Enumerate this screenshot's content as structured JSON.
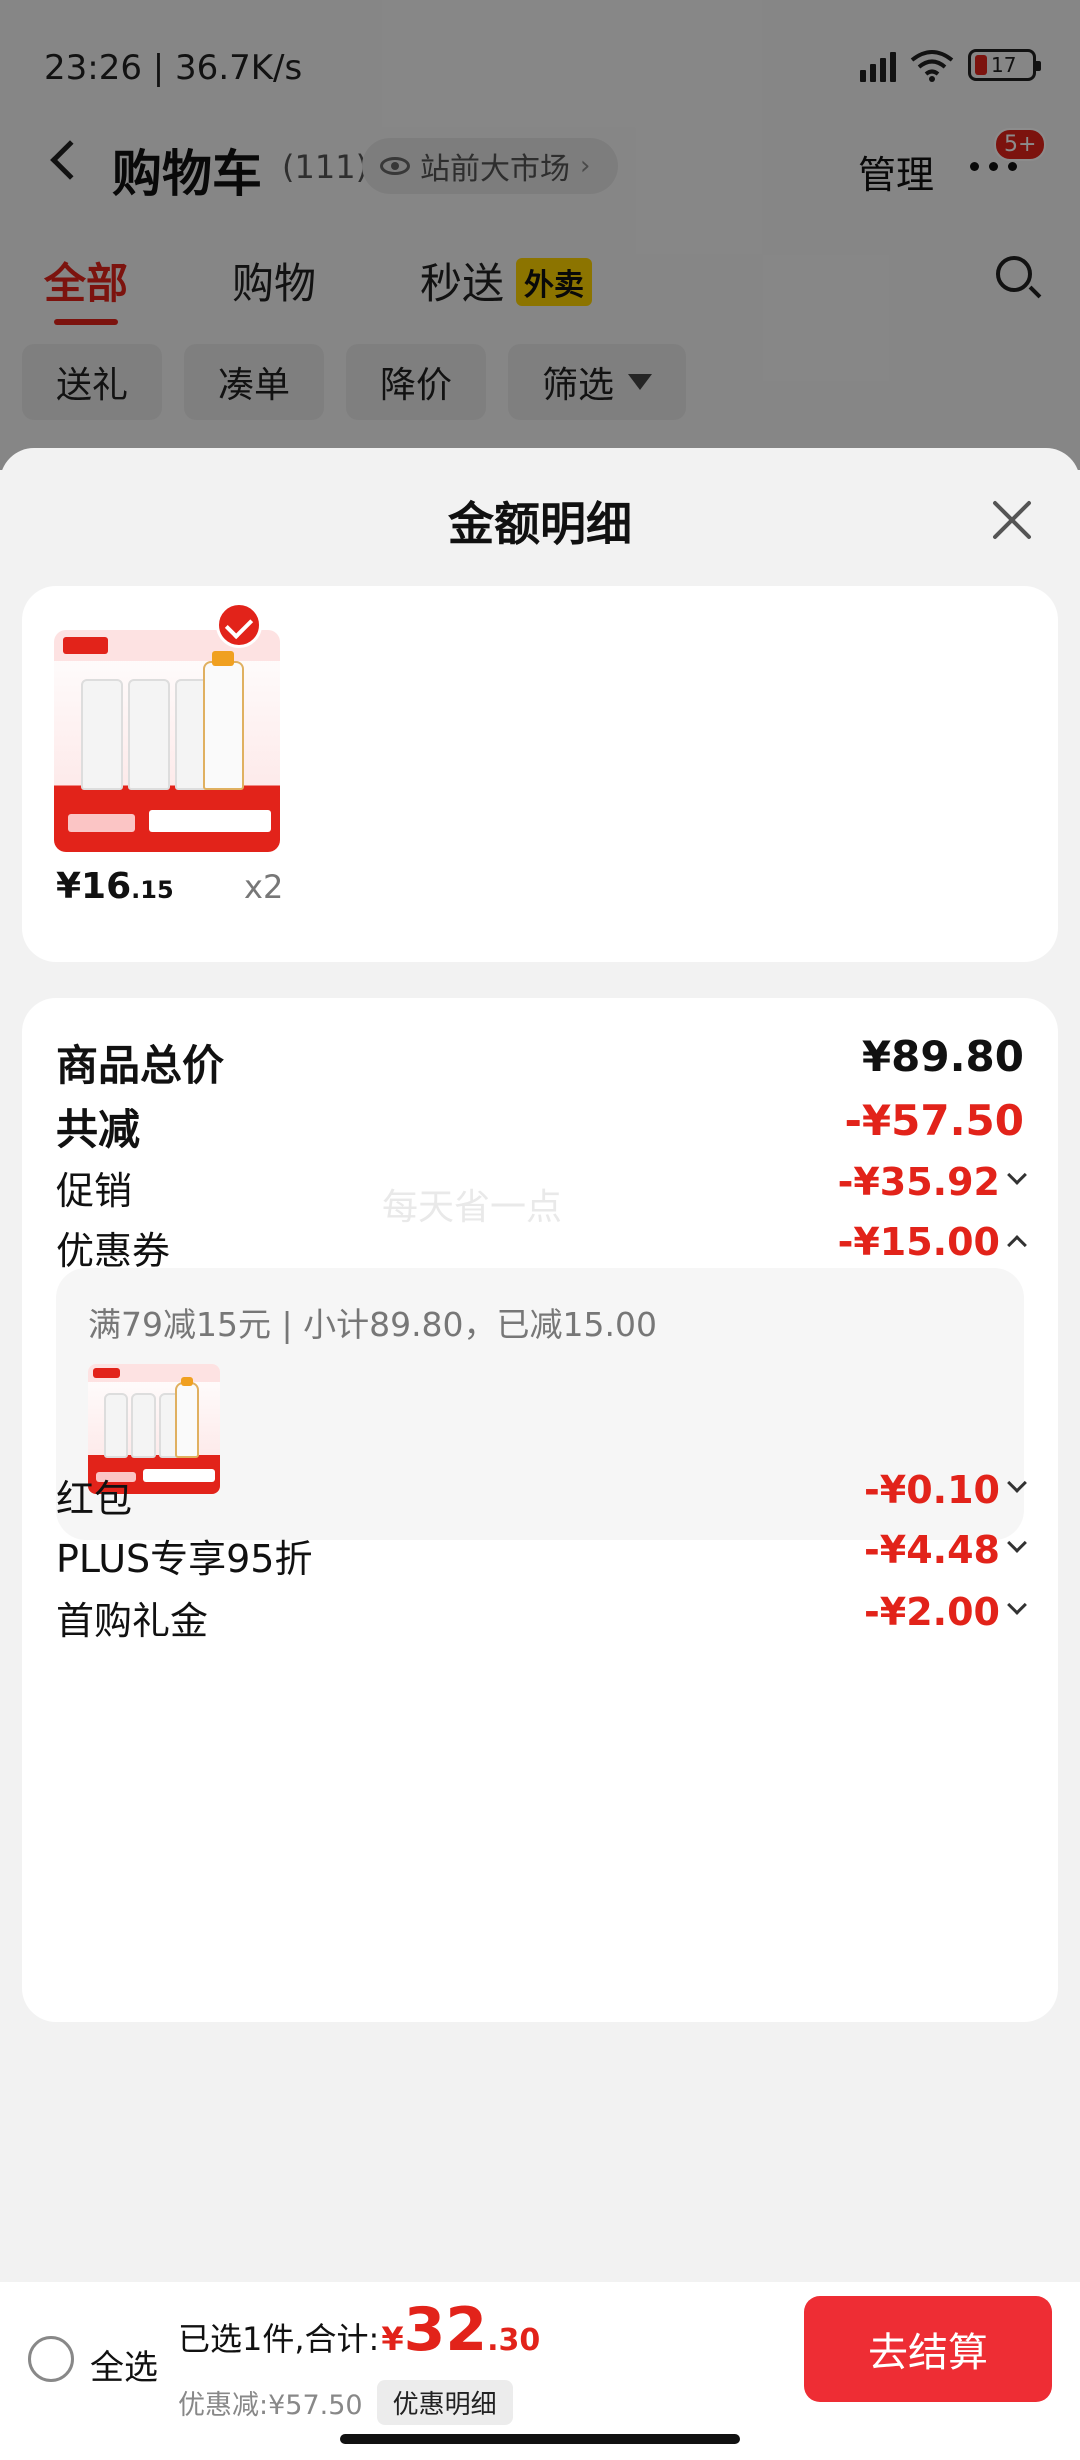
{
  "status_bar": {
    "time_speed": "23:26 | 36.7K/s",
    "battery": "17"
  },
  "nav": {
    "title": "购物车",
    "count": "(111)",
    "store": "站前大市场",
    "manage": "管理",
    "badge": "5+"
  },
  "tabs": [
    {
      "label": "全部"
    },
    {
      "label": "购物"
    },
    {
      "label": "秒送"
    }
  ],
  "takeout_tag": "外卖",
  "filter_chips": [
    "送礼",
    "凑单",
    "降价",
    "筛选"
  ],
  "sheet": {
    "title": "金额明细",
    "product": {
      "price_int": "¥16",
      "price_dec": ".15",
      "qty": "x2"
    },
    "rows": {
      "total_label": "商品总价",
      "total_value": "¥89.80",
      "saved_label": "共减",
      "saved_value": "-¥57.50",
      "promo_label": "促销",
      "promo_value": "-¥35.92",
      "coupon_label": "优惠券",
      "coupon_value": "-¥15.00",
      "coupon_detail": "满79减15元 | 小计89.80，已减15.00",
      "redpack_label": "红包",
      "redpack_value": "-¥0.10",
      "plus_label": "PLUS专享95折",
      "plus_value": "-¥4.48",
      "firstbuy_label": "首购礼金",
      "firstbuy_value": "-¥2.00"
    },
    "watermark": "每天省一点"
  },
  "bottom_bar": {
    "select_all": "全选",
    "summary_label": "已选1件,合计:",
    "yen": "¥",
    "price_int": "32",
    "price_dec": ".30",
    "discount_text": "优惠减:¥57.50",
    "discount_detail": "优惠明细",
    "checkout": "去结算"
  },
  "colors": {
    "accent": "#e2231a",
    "checkout": "#ee2d34",
    "takeout": "#ffd400"
  }
}
